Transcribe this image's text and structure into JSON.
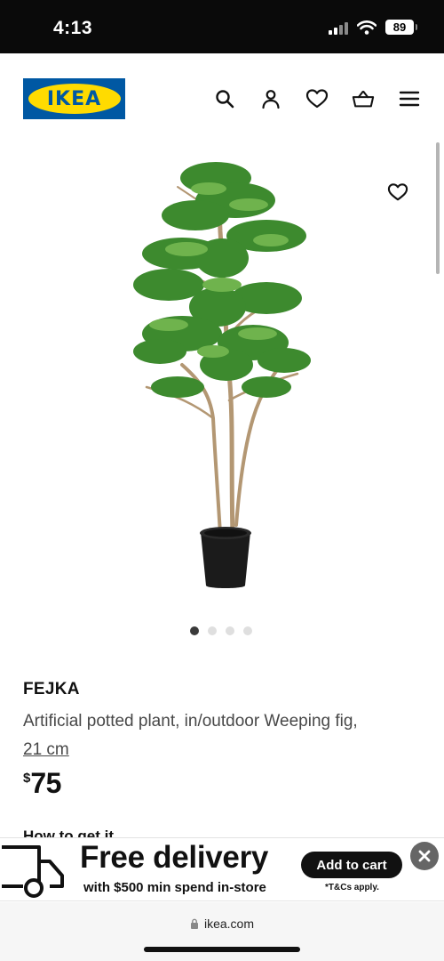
{
  "status_bar": {
    "time": "4:13",
    "battery": "89"
  },
  "header": {
    "logo_text": "IKEA",
    "icons": [
      "search-icon",
      "account-icon",
      "wishlist-icon",
      "cart-icon",
      "menu-icon"
    ]
  },
  "gallery": {
    "image_count": 4,
    "active_index": 0
  },
  "product": {
    "name": "FEJKA",
    "description": "Artificial potted plant, in/outdoor Weeping fig,",
    "size": "21 cm",
    "currency_symbol": "$",
    "price": "75"
  },
  "section_heading": "How to get it",
  "promo": {
    "headline": "Free delivery",
    "subline": "with $500 min spend in-store",
    "cta": "Add to cart",
    "terms": "*T&Cs apply."
  },
  "browser": {
    "url": "ikea.com"
  },
  "colors": {
    "brand_blue": "#0058a3",
    "brand_yellow": "#ffdb00"
  }
}
